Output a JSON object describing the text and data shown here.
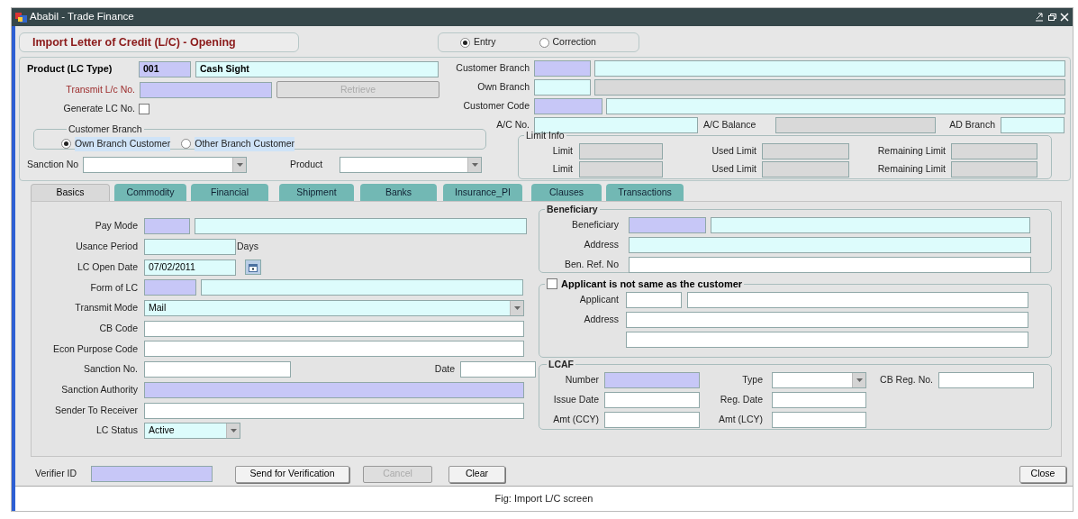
{
  "window": {
    "title": "Ababil - Trade Finance"
  },
  "form_title": "Import Letter of Credit (L/C) - Opening",
  "mode": [
    {
      "label": "Entry",
      "selected": true
    },
    {
      "label": "Correction",
      "selected": false
    }
  ],
  "product": {
    "label": "Product (LC Type)",
    "fields": [
      {
        "kind": "lookup",
        "value": "001"
      },
      {
        "kind": "input",
        "value": "Cash Sight"
      }
    ]
  },
  "transmit_lc_no": {
    "label": "Transmit L/c No.",
    "fields": [
      {
        "kind": "lookup"
      }
    ],
    "button": {
      "label": "Retrieve",
      "disabled": true
    }
  },
  "generate_lc_no": {
    "label": "Generate LC No.",
    "checked": false
  },
  "customer_branch_type": {
    "title": "Customer Branch",
    "options": [
      {
        "label": "Own Branch Customer",
        "selected": true
      },
      {
        "label": "Other Branch Customer",
        "selected": false
      }
    ]
  },
  "filters": [
    {
      "label": "Sanction No",
      "field": {
        "kind": "plain",
        "dropdown": true
      }
    },
    {
      "label": "Product",
      "field": {
        "kind": "plain",
        "dropdown": true
      }
    }
  ],
  "customer_rows": [
    {
      "label": "Customer Branch",
      "fields": [
        {
          "kind": "lookup"
        },
        {
          "kind": "input"
        }
      ]
    },
    {
      "label": "Own Branch",
      "fields": [
        {
          "kind": "input"
        },
        {
          "kind": "readonly"
        }
      ]
    },
    {
      "label": "Customer Code",
      "fields": [
        {
          "kind": "lookup"
        },
        {
          "kind": "input"
        }
      ]
    }
  ],
  "account_row": [
    {
      "label": "A/C No.",
      "field": {
        "kind": "input"
      }
    },
    {
      "label": "A/C Balance",
      "field": {
        "kind": "readonly"
      }
    },
    {
      "label": "AD Branch",
      "field": {
        "kind": "input"
      }
    }
  ],
  "limit_info": {
    "title": "Limit Info",
    "rows": [
      [
        {
          "label": "Limit",
          "field": {
            "kind": "readonly"
          }
        },
        {
          "label": "Used Limit",
          "field": {
            "kind": "readonly"
          }
        },
        {
          "label": "Remaining Limit",
          "field": {
            "kind": "readonly"
          }
        }
      ],
      [
        {
          "label": "Limit",
          "field": {
            "kind": "readonly"
          }
        },
        {
          "label": "Used Limit",
          "field": {
            "kind": "readonly"
          }
        },
        {
          "label": "Remaining Limit",
          "field": {
            "kind": "readonly"
          }
        }
      ]
    ]
  },
  "tabs": [
    {
      "label": "Basics",
      "selected": true
    },
    {
      "label": "Commodity",
      "selected": false
    },
    {
      "label": "Financial",
      "selected": false
    },
    {
      "label": "Shipment",
      "selected": false
    },
    {
      "label": "Banks",
      "selected": false
    },
    {
      "label": "Insurance_PI",
      "selected": false
    },
    {
      "label": "Clauses",
      "selected": false
    },
    {
      "label": "Transactions",
      "selected": false
    }
  ],
  "basics": [
    {
      "label": "Pay Mode",
      "fields": [
        {
          "kind": "lookup"
        },
        {
          "kind": "input"
        }
      ]
    },
    {
      "label": "Usance Period",
      "fields": [
        {
          "kind": "input"
        }
      ],
      "suffix": "Days"
    },
    {
      "label": "LC Open Date",
      "fields": [
        {
          "kind": "input",
          "value": "07/02/2011",
          "calendar": true
        }
      ]
    },
    {
      "label": "Form of LC",
      "fields": [
        {
          "kind": "lookup"
        },
        {
          "kind": "input"
        }
      ]
    },
    {
      "label": "Transmit Mode",
      "fields": [
        {
          "kind": "input",
          "value": "Mail",
          "dropdown": true
        }
      ]
    },
    {
      "label": "CB Code",
      "fields": [
        {
          "kind": "plain"
        }
      ]
    },
    {
      "label": "Econ Purpose Code",
      "fields": [
        {
          "kind": "plain"
        }
      ]
    },
    {
      "label": "Sanction No.",
      "fields": [
        {
          "kind": "plain"
        },
        {
          "kind": "plain",
          "label": "Date"
        }
      ]
    },
    {
      "label": "Sanction Authority",
      "fields": [
        {
          "kind": "lookup"
        }
      ]
    },
    {
      "label": "Sender To Receiver",
      "fields": [
        {
          "kind": "plain"
        }
      ]
    },
    {
      "label": "LC Status",
      "fields": [
        {
          "kind": "input",
          "value": "Active",
          "dropdown": true
        }
      ]
    }
  ],
  "beneficiary": {
    "title": "Beneficiary",
    "rows": [
      {
        "label": "Beneficiary",
        "fields": [
          {
            "kind": "lookup"
          },
          {
            "kind": "input"
          }
        ]
      },
      {
        "label": "Address",
        "fields": [
          {
            "kind": "input"
          }
        ]
      },
      {
        "label": "Ben. Ref. No",
        "fields": [
          {
            "kind": "plain"
          }
        ]
      }
    ]
  },
  "applicant": {
    "title": "Applicant is not same as the customer",
    "checked": false,
    "rows": [
      {
        "label": "Applicant",
        "fields": [
          {
            "kind": "plain"
          },
          {
            "kind": "plain"
          }
        ]
      },
      {
        "label": "Address",
        "fields": [
          {
            "kind": "plain"
          }
        ]
      },
      {
        "fields": [
          {
            "kind": "plain"
          }
        ]
      }
    ]
  },
  "lcaf": {
    "title": "LCAF",
    "rows": [
      [
        {
          "label": "Number",
          "field": {
            "kind": "lookup"
          }
        },
        {
          "label": "Type",
          "field": {
            "kind": "plain",
            "dropdown": true
          }
        },
        {
          "label": "CB Reg. No.",
          "field": {
            "kind": "plain"
          }
        }
      ],
      [
        {
          "label": "Issue Date",
          "field": {
            "kind": "plain"
          }
        },
        {
          "label": "Reg. Date",
          "field": {
            "kind": "plain"
          }
        }
      ],
      [
        {
          "label": "Amt (CCY)",
          "field": {
            "kind": "plain"
          }
        },
        {
          "label": "Amt (LCY)",
          "field": {
            "kind": "plain"
          }
        }
      ]
    ]
  },
  "footer": {
    "label": "Verifier ID",
    "field": {
      "kind": "lookup"
    },
    "buttons": [
      {
        "label": "Send for Verification",
        "disabled": false
      },
      {
        "label": "Cancel",
        "disabled": true
      },
      {
        "label": "Clear",
        "disabled": false
      },
      {
        "label": "Close",
        "disabled": false
      }
    ]
  },
  "caption": "Fig: Import L/C screen"
}
